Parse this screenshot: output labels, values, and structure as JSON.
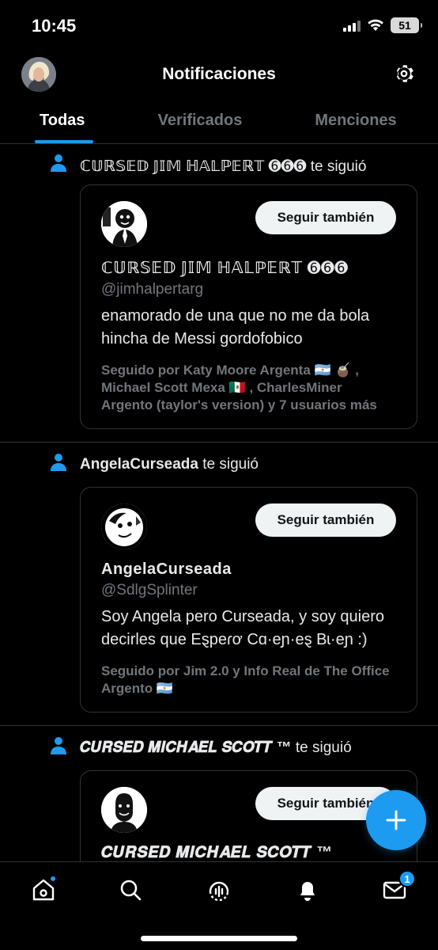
{
  "status_bar": {
    "time": "10:45",
    "battery": "51"
  },
  "header": {
    "title": "Notificaciones"
  },
  "tabs": [
    {
      "label": "Todas",
      "active": true
    },
    {
      "label": "Verificados",
      "active": false
    },
    {
      "label": "Menciones",
      "active": false
    }
  ],
  "notifications": [
    {
      "actor": "ℂ𝕌ℝ𝕊𝔼𝔻 𝕁𝕀𝕄 ℍ𝔸𝕃ℙ𝔼ℝ𝕋 ➏➏➏",
      "action": "te siguió",
      "card": {
        "name": "ℂ𝕌ℝ𝕊𝔼𝔻 𝕁𝕀𝕄 ℍ𝔸𝕃ℙ𝔼ℝ𝕋 ➏➏➏",
        "handle": "@jimhalpertarg",
        "bio": "enamorado de una que no me da bola hincha de Messi gordofobico",
        "followed_by": "Seguido por Katy Moore Argenta 🇦🇷 🧉 , Michael Scott Mexa 🇲🇽 , CharlesMiner Argento (taylor's version) y 7 usuarios más",
        "button": "Seguir también"
      }
    },
    {
      "actor": "AngelaCurseada",
      "action": "te siguió",
      "card": {
        "name": "AngelaCurseada",
        "handle": "@SdlgSplinter",
        "bio": "Soy Angela pero Curseada, y soy quiero decirles que Eȿpeɾơ Cɑ·eɲ·eȿ Bɩ·eɲ :)",
        "followed_by": "Seguido por Jim 2.0 y Info Real de The Office Argento 🇦🇷",
        "button": "Seguir también"
      }
    },
    {
      "actor": "𝑪𝑼𝑹𝑺𝑬𝑫 𝑴𝑰𝑪𝑯𝑨𝑬𝑳 𝑺𝑪𝑶𝑻𝑻 ™",
      "action": "te siguió",
      "card": {
        "name": "𝑪𝑼𝑹𝑺𝑬𝑫 𝑴𝑰𝑪𝑯𝑨𝑬𝑳 𝑺𝑪𝑶𝑻𝑻 ™",
        "handle": "",
        "bio": "",
        "followed_by": "",
        "button": "Seguir también"
      }
    }
  ],
  "bottom_nav": {
    "items": [
      "home-icon",
      "search-icon",
      "spaces-icon",
      "notifications-icon",
      "messages-icon"
    ],
    "messages_badge": "1"
  },
  "colors": {
    "accent": "#1d9bf0",
    "background": "#000000",
    "muted": "#71767b",
    "border": "#2f3336"
  }
}
